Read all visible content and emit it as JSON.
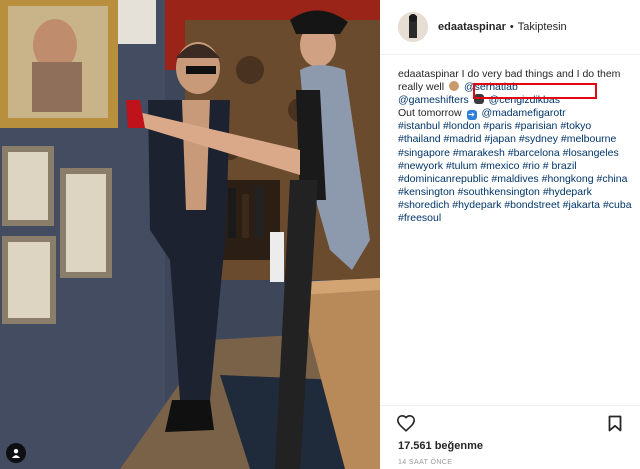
{
  "post": {
    "username": "edaataspinar",
    "separator": "•",
    "follow_status": "Takiptesin"
  },
  "caption": {
    "username": "edaataspinar",
    "line1": "I do very bad things and I do them really well",
    "mention1": "@serhatlab",
    "mention2": "@gameshifters",
    "mention3": "@cengizdikbas",
    "out_text": "Out tomorrow",
    "mention4": "@madamefigarotr",
    "hashtags": [
      "#istanbul",
      "#london",
      "#paris",
      "#parisian",
      "#tokyo",
      "#thailand",
      "#madrid",
      "#japan",
      "#sydney",
      "#melbourne",
      "#singapore",
      "#marakesh",
      "#barcelona",
      "#losangeles",
      "#newyork",
      "#tulum",
      "#mexico",
      "#rio",
      "# brazil",
      "#dominicanrepublic",
      "#maldives",
      "#hongkong",
      "#china",
      "#kensington",
      "#southkensington",
      "#hydepark",
      "#shoredich",
      "#hydepark",
      "#bondstreet",
      "#jakarta",
      "#cuba",
      "#freesoul"
    ]
  },
  "stats": {
    "likes": "17.561 beğenme",
    "time": "14 SAAT ÖNCE"
  },
  "icons": {
    "like": "heart-icon",
    "save": "bookmark-icon",
    "tagged": "user-tag-icon"
  },
  "colors": {
    "link": "#003569",
    "highlight": "#e30613",
    "wall": "#3d4658"
  }
}
